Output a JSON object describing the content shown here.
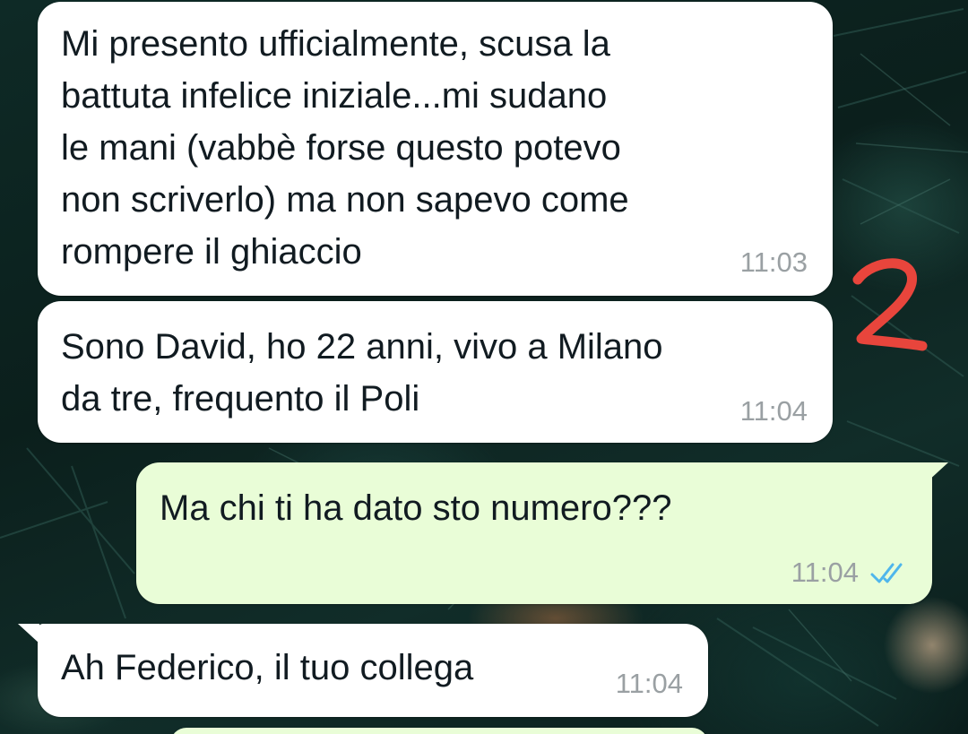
{
  "chat": {
    "messages": [
      {
        "direction": "incoming",
        "text": "Mi presento ufficialmente, scusa la\nbattuta infelice iniziale...mi sudano\nle mani (vabbè forse questo potevo\nnon scriverlo) ma non sapevo come\nrompere il ghiaccio",
        "time": "11:03"
      },
      {
        "direction": "incoming",
        "text": "Sono David, ho 22 anni, vivo a Milano\nda tre, frequento il Poli",
        "time": "11:04"
      },
      {
        "direction": "outgoing",
        "text": "Ma chi ti ha dato sto numero???",
        "time": "11:04",
        "status": "read",
        "status_icon": "double-check-icon"
      },
      {
        "direction": "incoming",
        "text": "Ah Federico, il tuo collega",
        "time": "11:04"
      }
    ]
  },
  "annotation": {
    "handwritten_mark": "2",
    "color": "#e8453c"
  },
  "colors": {
    "incoming_bubble": "#ffffff",
    "outgoing_bubble": "#e9fdd7",
    "timestamp": "#9aa0a3",
    "read_ticks": "#4fb6ec",
    "text": "#111b21"
  }
}
